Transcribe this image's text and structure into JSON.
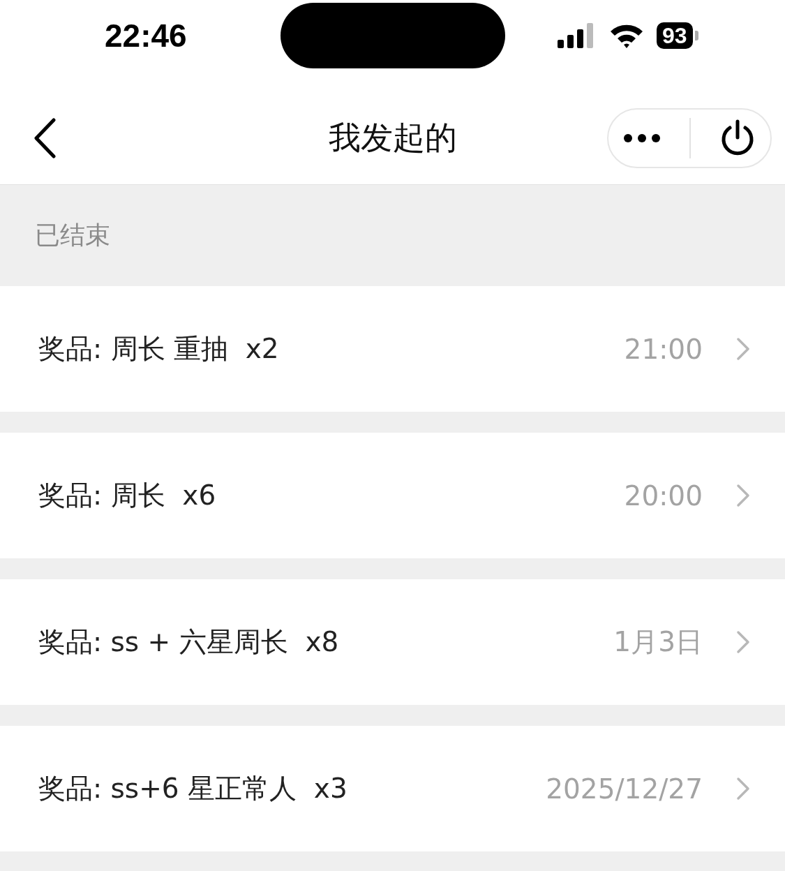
{
  "status_bar": {
    "time": "22:46",
    "battery": "93"
  },
  "nav": {
    "title": "我发起的"
  },
  "section": {
    "title": "已结束"
  },
  "rows": [
    {
      "prize": "奖品: 周长 重抽  x2",
      "time": "21:00"
    },
    {
      "prize": "奖品: 周长  x6",
      "time": "20:00"
    },
    {
      "prize": "奖品: ss + 六星周长  x8",
      "time": "1月3日"
    },
    {
      "prize": "奖品: ss+6 星正常人  x3",
      "time": "2025/12/27"
    }
  ]
}
